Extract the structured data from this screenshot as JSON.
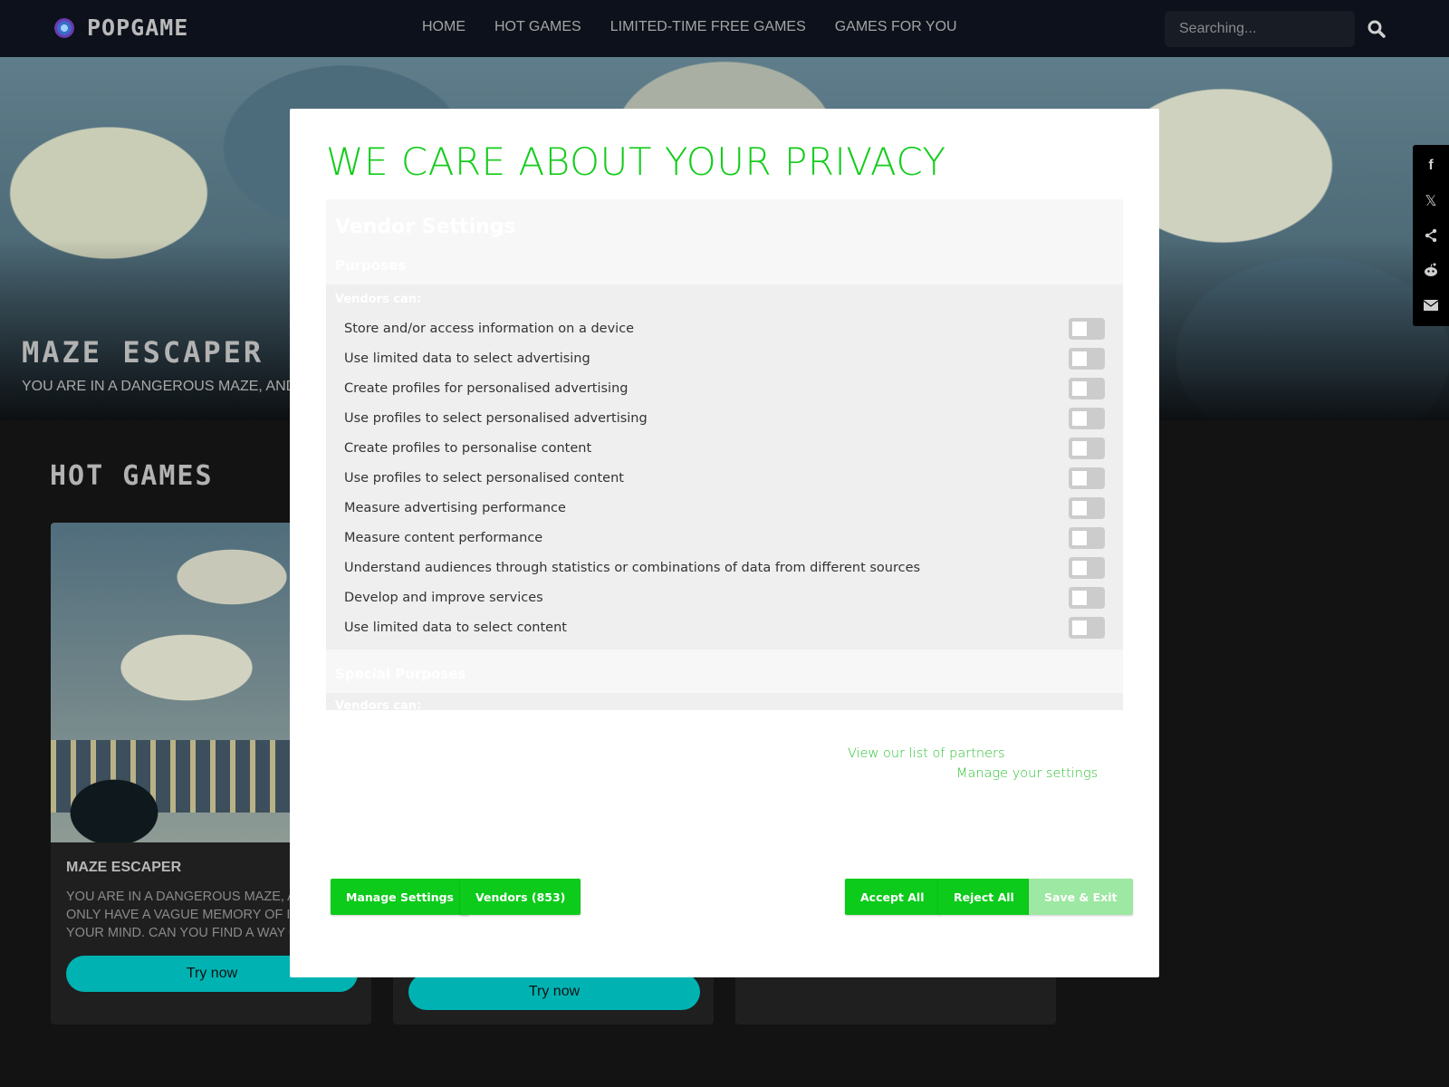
{
  "header": {
    "brand": "POPGAME",
    "nav": [
      "HOME",
      "HOT GAMES",
      "LIMITED-TIME FREE GAMES",
      "GAMES FOR YOU"
    ],
    "search_placeholder": "Searching..."
  },
  "hero": {
    "title": "MAZE ESCAPER",
    "description": "YOU ARE IN A DANGEROUS MAZE, AND"
  },
  "share": [
    "facebook-icon",
    "x-icon",
    "share-icon",
    "reddit-icon",
    "email-icon"
  ],
  "hot_games": {
    "title": "HOT GAMES",
    "cards": [
      {
        "title": "MAZE ESCAPER",
        "description": "YOU ARE IN A DANGEROUS MAZE, AND YOU ONLY HAVE A VAGUE MEMORY OF IT IN YOUR MIND. CAN YOU FIND A WAY OUT?",
        "button": "Try now"
      },
      {
        "button": "Try now"
      },
      {}
    ]
  },
  "consent": {
    "title": "WE CARE ABOUT YOUR PRIVACY",
    "vendor_settings": "Vendor Settings",
    "purposes_heading": "Purposes",
    "vendors_can": "Vendors can:",
    "purposes": [
      "Store and/or access information on a device",
      "Use limited data to select advertising",
      "Create profiles for personalised advertising",
      "Use profiles to select personalised advertising",
      "Create profiles to personalise content",
      "Use profiles to select personalised content",
      "Measure advertising performance",
      "Measure content performance",
      "Understand audiences through statistics or combinations of data from different sources",
      "Develop and improve services",
      "Use limited data to select content"
    ],
    "special_purposes_heading": "Special Purposes",
    "special_vendors_can": "Vendors can:",
    "links": {
      "partners": "View our list of partners",
      "manage": "Manage your settings"
    },
    "buttons": {
      "manage_settings": "Manage Settings",
      "vendors": "Vendors (853)",
      "accept_all": "Accept All",
      "reject_all": "Reject All",
      "save_exit": "Save & Exit"
    },
    "colors": {
      "accent": "#0ccb1a",
      "accent_disabled": "#9de8a2"
    }
  }
}
